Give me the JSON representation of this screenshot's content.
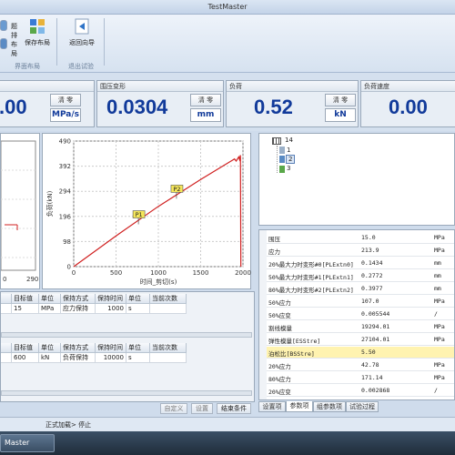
{
  "window": {
    "title": "TestMaster"
  },
  "ribbon": {
    "clip_label_1": "题排",
    "clip_label_2": "布局",
    "save_layout": "保存布局",
    "back_guide": "返回向导",
    "group_layout": "界面布局",
    "group_exit": "退出试验"
  },
  "gauges": [
    {
      "title": "",
      "value": ".00",
      "btn": "清 零",
      "unit": "MPa/s"
    },
    {
      "title": "围压变形",
      "value": "0.0304",
      "btn": "清 零",
      "unit": "mm"
    },
    {
      "title": "负荷",
      "value": "0.52",
      "btn": "清 零",
      "unit": "kN"
    },
    {
      "title": "负荷速度",
      "value": "0.00",
      "btn": ""
    }
  ],
  "chart_left": {
    "xticks": [
      "0",
      "290"
    ]
  },
  "chart_data": {
    "type": "line",
    "title": "",
    "xlabel": "时间_剪切(s)",
    "ylabel": "负荷(kN)",
    "xlim": [
      0,
      2000
    ],
    "ylim": [
      0,
      490
    ],
    "xticks": [
      "0",
      "500",
      "1000",
      "1500",
      "2000"
    ],
    "yticks": [
      "0",
      "98",
      "196",
      "294",
      "392",
      "490"
    ],
    "series": [
      {
        "color": "#d02020",
        "points": [
          [
            0,
            0
          ],
          [
            500,
            120
          ],
          [
            1000,
            235
          ],
          [
            1500,
            340
          ],
          [
            1900,
            420
          ],
          [
            1920,
            412
          ],
          [
            1950,
            428
          ],
          [
            1960,
            418
          ],
          [
            1970,
            435
          ],
          [
            1975,
            0
          ]
        ]
      }
    ],
    "markers": [
      {
        "label": "P1",
        "x": 700,
        "y": 165
      },
      {
        "label": "P2",
        "x": 1150,
        "y": 265
      }
    ]
  },
  "tree": {
    "root": "14",
    "children": [
      "1",
      "2",
      "3"
    ]
  },
  "props": {
    "rows": [
      {
        "name": "围压",
        "value": "15.0",
        "unit": "MPa"
      },
      {
        "name": "应力",
        "value": "213.9",
        "unit": "MPa"
      },
      {
        "name": "20%最大力时变形#0[PLExtn0]",
        "value": "0.1434",
        "unit": "mm"
      },
      {
        "name": "50%最大力时变形#1[PLExtn1]",
        "value": "0.2772",
        "unit": "mm"
      },
      {
        "name": "80%最大力时变形#2[PLExtn2]",
        "value": "0.3977",
        "unit": "mm"
      },
      {
        "name": "50%应力",
        "value": "107.0",
        "unit": "MPa"
      },
      {
        "name": "50%应变",
        "value": "0.005544",
        "unit": "/"
      },
      {
        "name": "割线模量",
        "value": "19294.01",
        "unit": "MPa"
      },
      {
        "name": "弹性模量[ESStre]",
        "value": "27104.01",
        "unit": "MPa"
      },
      {
        "name": "泊松比[BSStre]",
        "value": "5.50",
        "unit": ""
      },
      {
        "name": "20%应力",
        "value": "42.78",
        "unit": "MPa"
      },
      {
        "name": "80%应力",
        "value": "171.14",
        "unit": "MPa"
      },
      {
        "name": "20%应变",
        "value": "0.002868",
        "unit": "/"
      }
    ],
    "tabs": [
      "设置项",
      "参数项",
      "组参数项",
      "试验过程"
    ]
  },
  "table1": {
    "headers": [
      "",
      "目标值",
      "单位",
      "保持方式",
      "保持时间",
      "单位",
      "当前次数"
    ],
    "row": [
      "",
      "15",
      "MPa",
      "应力保持",
      "1000",
      "s",
      ""
    ]
  },
  "table2": {
    "headers": [
      "",
      "目标值",
      "单位",
      "保持方式",
      "保持时间",
      "单位",
      "当前次数"
    ],
    "row": [
      "",
      "600",
      "kN",
      "负荷保持",
      "10000",
      "s",
      ""
    ]
  },
  "footer_buttons": {
    "custom": "自定义",
    "settings": "设置",
    "end_cond": "结束条件"
  },
  "status": {
    "text": "正式加载> 停止"
  },
  "taskbar": {
    "label": "Master"
  }
}
